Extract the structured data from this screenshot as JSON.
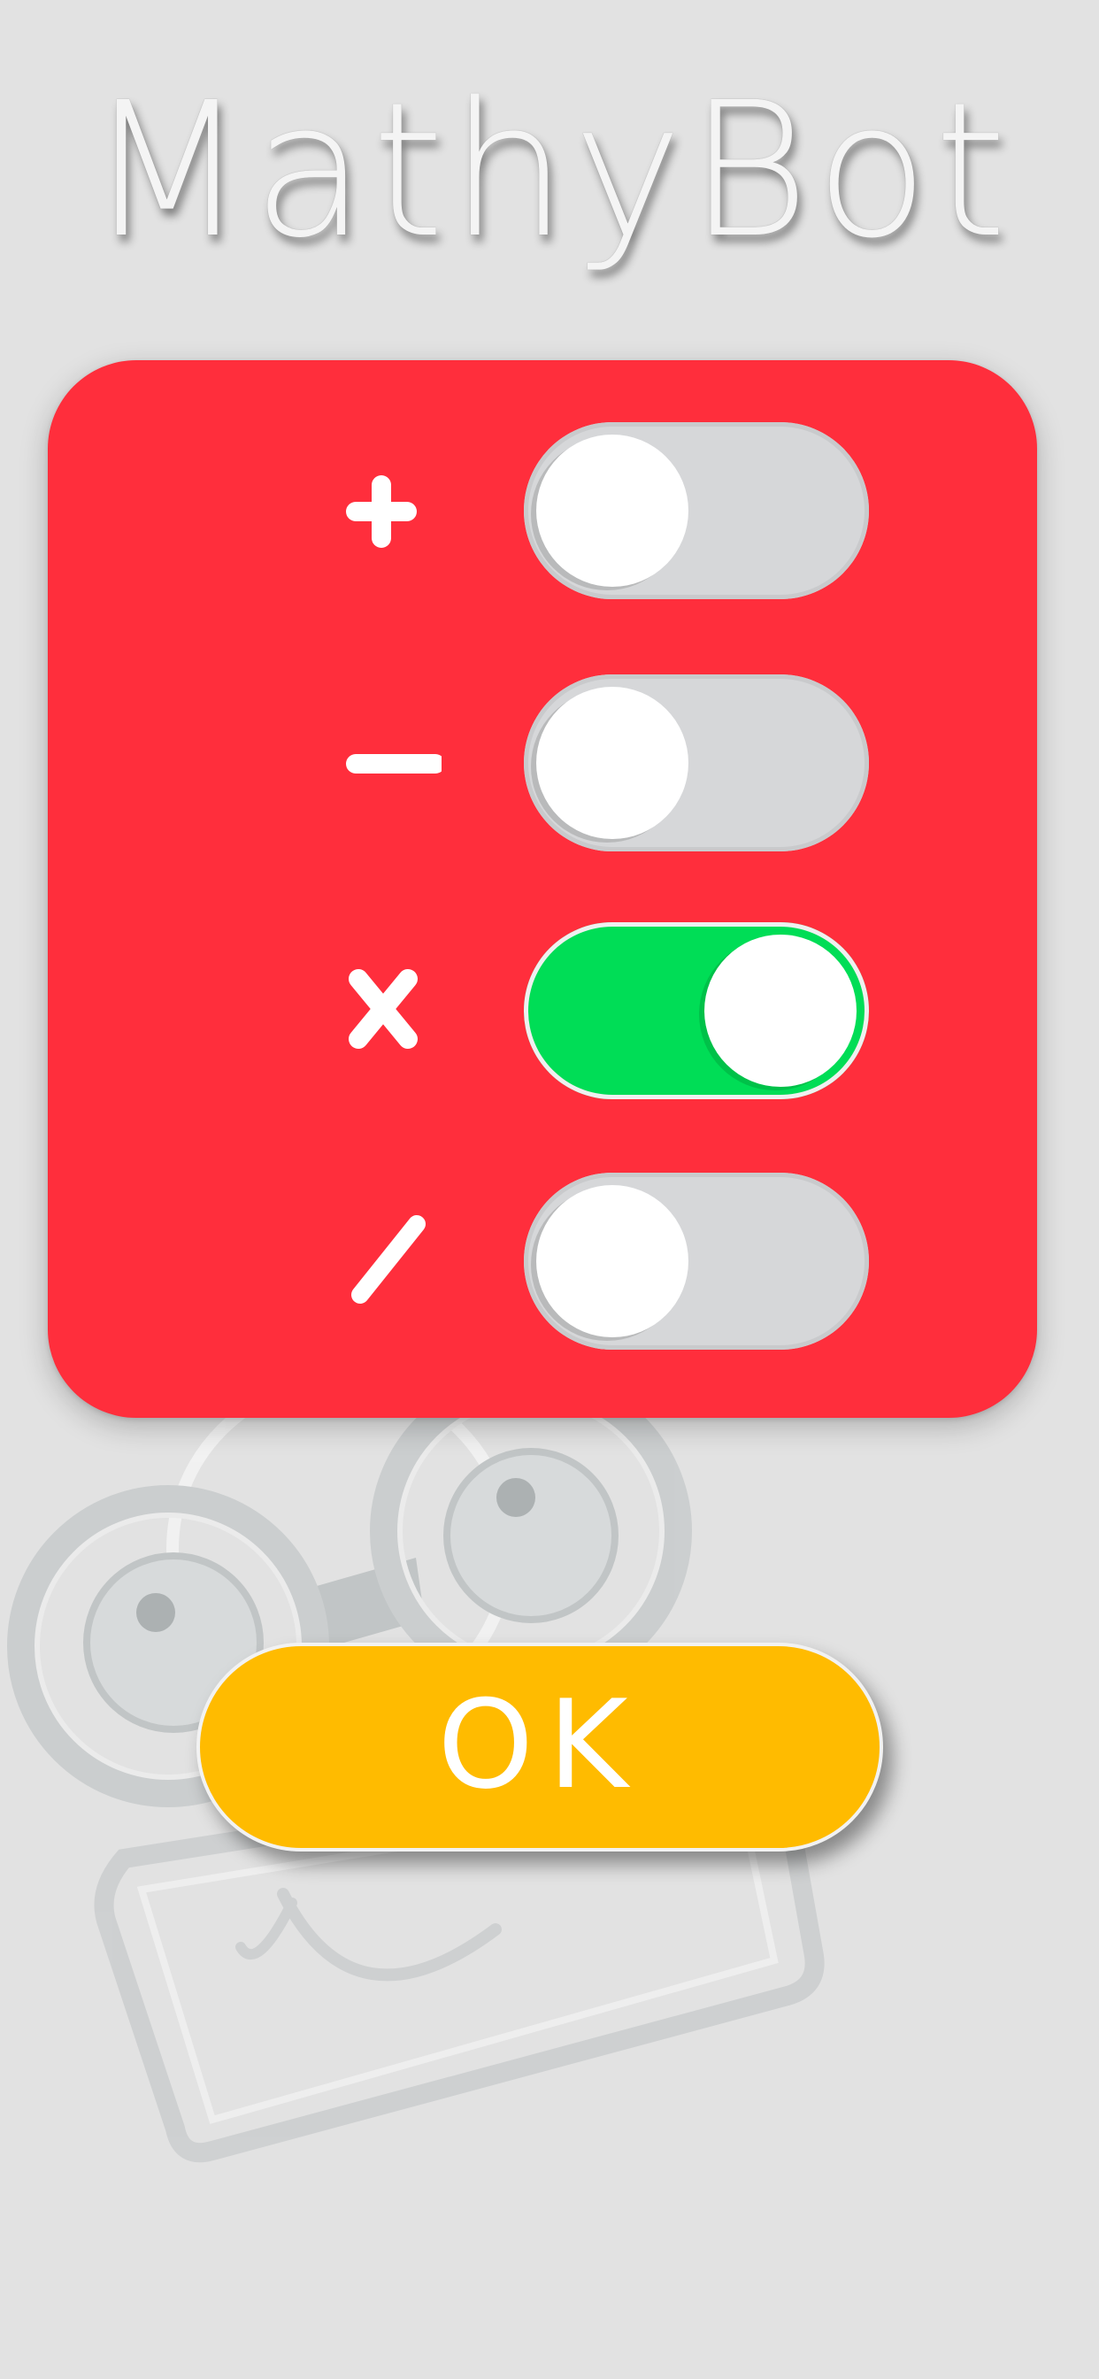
{
  "app": {
    "title": "MathyBot"
  },
  "operations": [
    {
      "id": "add",
      "icon": "plus-icon",
      "enabled": false
    },
    {
      "id": "subtract",
      "icon": "minus-icon",
      "enabled": false
    },
    {
      "id": "multiply",
      "icon": "multiply-icon",
      "enabled": true
    },
    {
      "id": "divide",
      "icon": "divide-slash-icon",
      "enabled": false
    }
  ],
  "ok_button": {
    "label": "OK"
  },
  "colors": {
    "background": "#e2e2e2",
    "panel": "#ff2e3c",
    "toggle_on": "#00dd56",
    "toggle_off": "#d6d7d9",
    "ok_button": "#ffbb00",
    "title": "#f4f4f4"
  }
}
